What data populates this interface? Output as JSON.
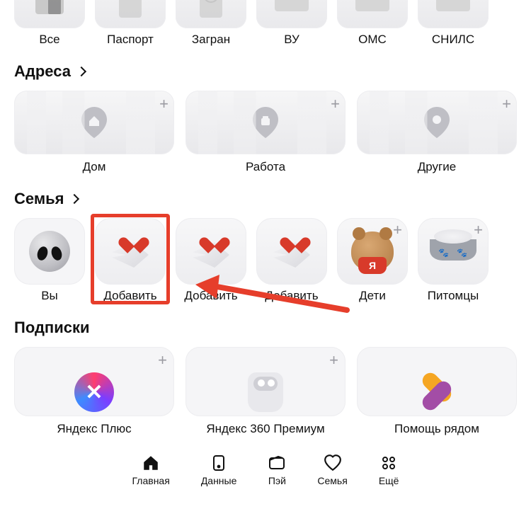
{
  "docs": {
    "items": [
      {
        "label": "Все"
      },
      {
        "label": "Паспорт"
      },
      {
        "label": "Загран"
      },
      {
        "label": "ВУ"
      },
      {
        "label": "ОМС"
      },
      {
        "label": "СНИЛС"
      }
    ]
  },
  "addresses": {
    "title": "Адреса",
    "items": [
      {
        "label": "Дом"
      },
      {
        "label": "Работа"
      },
      {
        "label": "Другие"
      }
    ]
  },
  "family": {
    "title": "Семья",
    "items": [
      {
        "label": "Вы",
        "icon": "alien-icon"
      },
      {
        "label": "Добавить",
        "icon": "heart-plane-icon",
        "highlighted": true
      },
      {
        "label": "Добавить",
        "icon": "heart-plane-icon"
      },
      {
        "label": "Добавить",
        "icon": "heart-plane-icon"
      },
      {
        "label": "Дети",
        "icon": "bear-icon",
        "plus": true
      },
      {
        "label": "Питомцы",
        "icon": "bowl-icon",
        "plus": true
      }
    ]
  },
  "subscriptions": {
    "title": "Подписки",
    "items": [
      {
        "label": "Яндекс Плюс",
        "icon": "yplus-icon",
        "plus": true
      },
      {
        "label": "Яндекс 360 Премиум",
        "icon": "y360-icon",
        "plus": true
      },
      {
        "label": "Помощь рядом",
        "icon": "help-icon"
      }
    ]
  },
  "nav": {
    "items": [
      {
        "label": "Главная",
        "icon": "home-icon"
      },
      {
        "label": "Данные",
        "icon": "card-icon"
      },
      {
        "label": "Пэй",
        "icon": "wallet-icon"
      },
      {
        "label": "Семья",
        "icon": "heart-icon"
      },
      {
        "label": "Ещё",
        "icon": "grid-icon"
      }
    ]
  }
}
